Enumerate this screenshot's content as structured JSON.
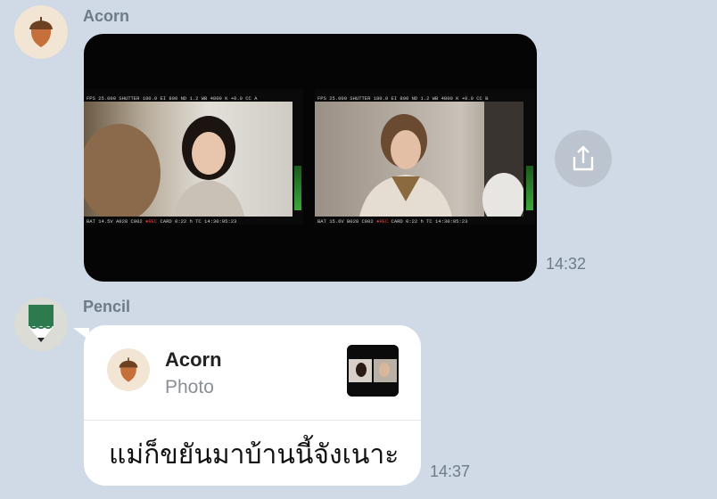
{
  "messages": [
    {
      "sender": "Acorn",
      "type": "photo",
      "time": "14:32",
      "photo": {
        "monitor_a": {
          "top_meta": "FPS 25.000  SHUTTER 180.0    EI 800  ND 1.2   WB 4800 K +0.0 CC  A",
          "bottom_meta": "BAT 14.5V     A028 C002  ●REC    CARD   0:22 h    TC 14:30:05:23"
        },
        "monitor_b": {
          "top_meta": "FPS 25.000  SHUTTER 180.0    EI 800  ND 1.2   WB 4800 K +0.0 CC  B",
          "bottom_meta": "BAT 15.6V     B028 C002  ●REC    CARD   0:22 h    TC 14:30:05:23"
        }
      }
    },
    {
      "sender": "Pencil",
      "type": "text",
      "time": "14:37",
      "reply": {
        "name": "Acorn",
        "type_label": "Photo"
      },
      "text": "แม่ก็ขยันมาบ้านนี้จังเนาะ"
    }
  ],
  "icons": {
    "acorn_avatar": "acorn-icon",
    "pencil_avatar": "pencil-icon",
    "share": "share-icon"
  },
  "colors": {
    "background": "#d0d9e6",
    "bubble": "#ffffff",
    "meta_text": "#6f7b88",
    "share_button": "#bcc4cf"
  }
}
